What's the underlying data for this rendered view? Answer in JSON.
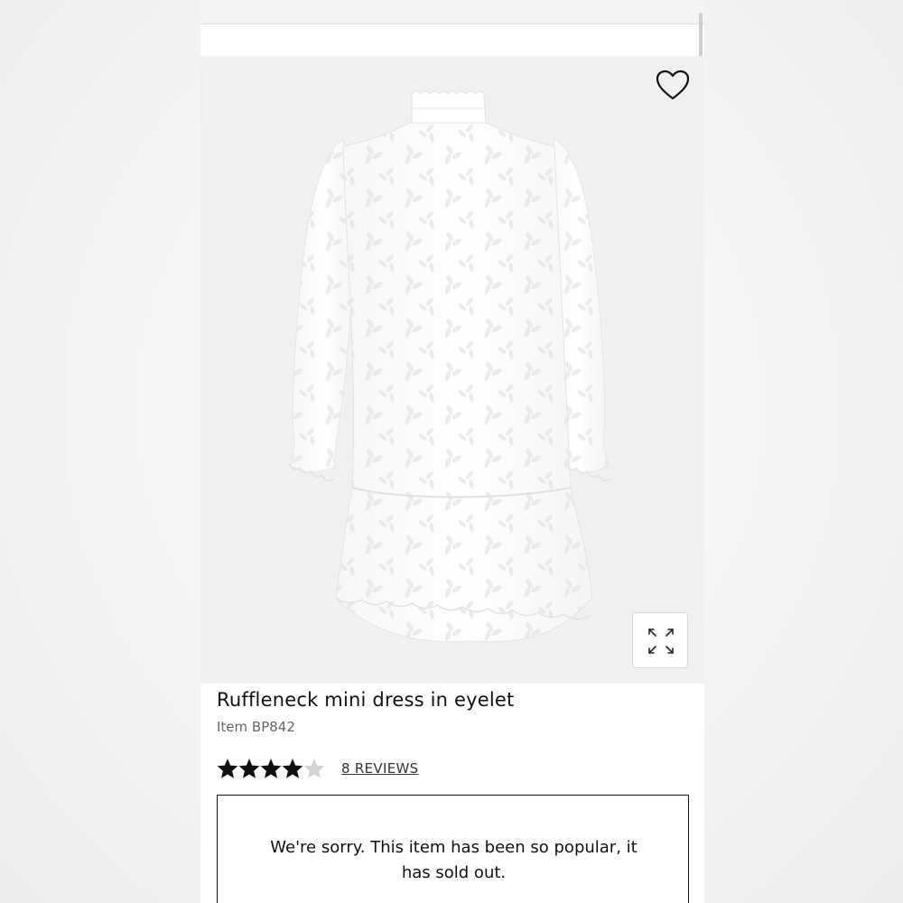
{
  "product": {
    "title": "Ruffleneck mini dress in eyelet",
    "item_label": "Item BP842",
    "rating": 4.5,
    "rating_max": 5,
    "reviews_label": "8 REVIEWS",
    "image_alt": "white eyelet dress"
  },
  "actions": {
    "wishlist_icon": "heart-icon",
    "expand_icon": "expand-arrows-icon"
  },
  "notice": {
    "message": "We're sorry. This item has been so popular, it has sold out."
  },
  "colors": {
    "star": "#111111",
    "border": "#111111",
    "image_bg": "#f0f0f0",
    "muted_text": "#666666"
  }
}
